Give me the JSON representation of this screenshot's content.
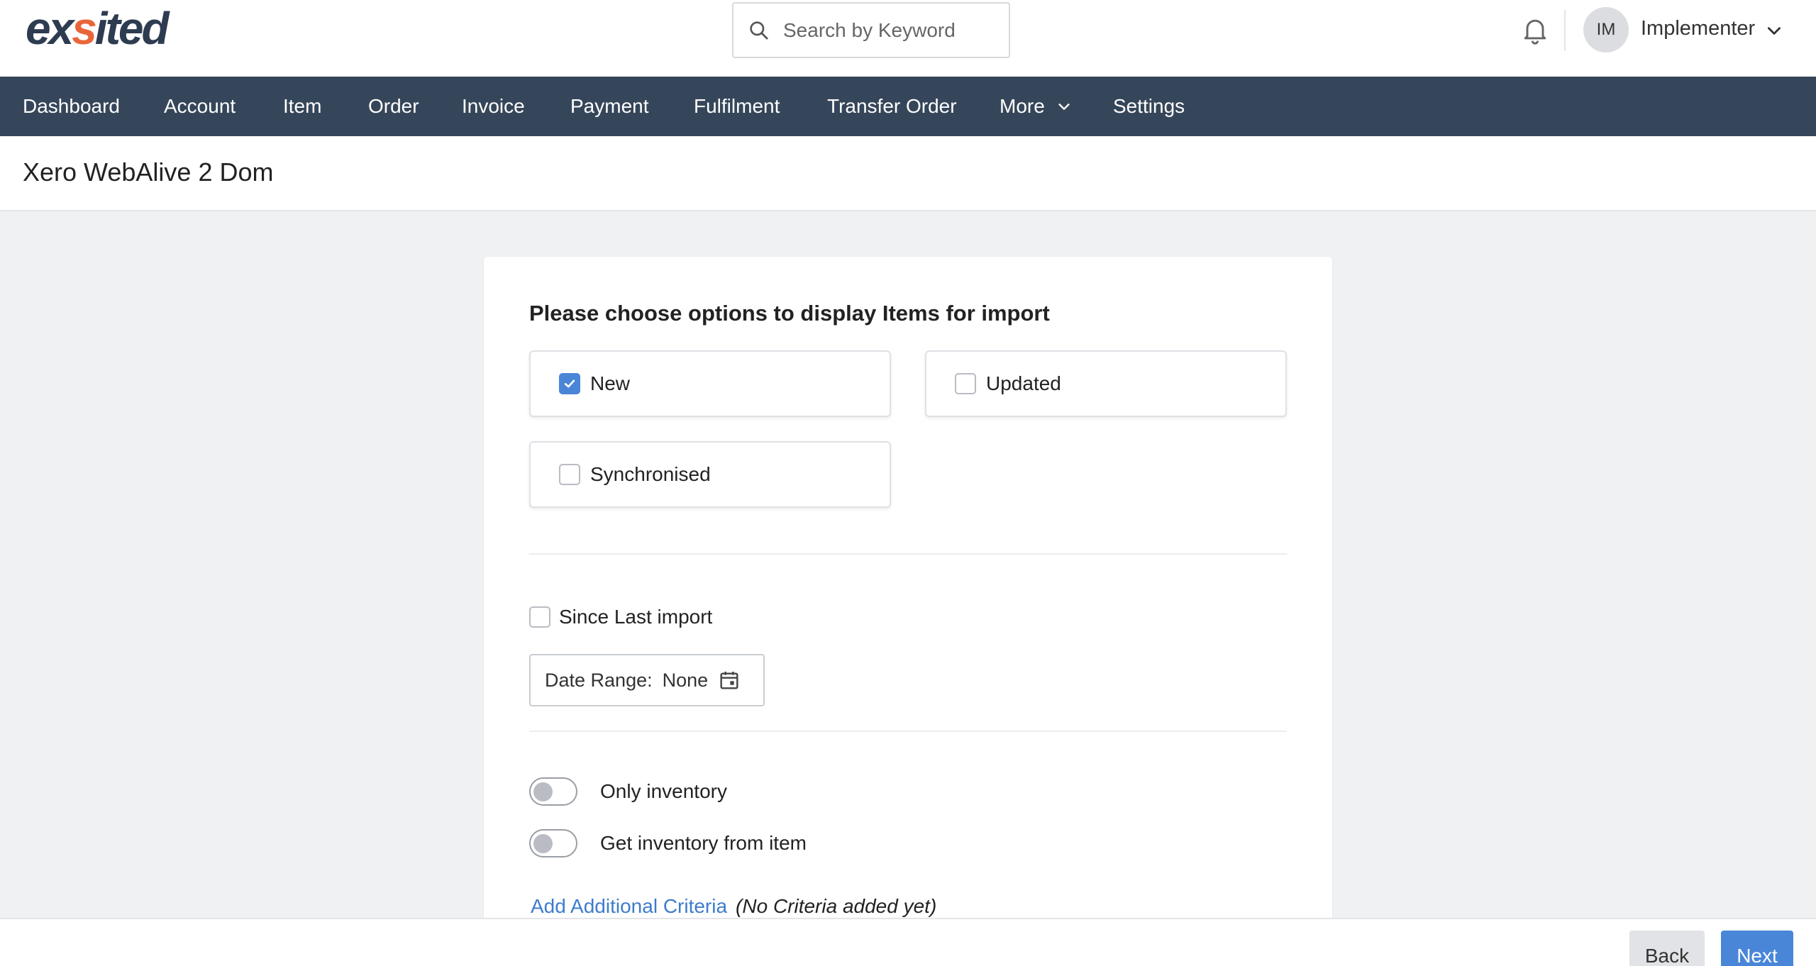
{
  "header": {
    "logo_text_left": "ex",
    "logo_text_accent": "s",
    "logo_text_right": "ited",
    "search_placeholder": "Search by Keyword",
    "user_initials": "IM",
    "user_name": "Implementer"
  },
  "nav": {
    "items": [
      "Dashboard",
      "Account",
      "Item",
      "Order",
      "Invoice",
      "Payment",
      "Fulfilment",
      "Transfer Order",
      "More",
      "Settings"
    ]
  },
  "page": {
    "title": "Xero WebAlive 2 Dom"
  },
  "form": {
    "heading": "Please choose options to display Items for import",
    "options": [
      {
        "label": "New",
        "checked": true
      },
      {
        "label": "Updated",
        "checked": false
      },
      {
        "label": "Synchronised",
        "checked": false
      }
    ],
    "since_last_import": {
      "label": "Since Last import",
      "checked": false
    },
    "date_range": {
      "label": "Date Range:",
      "value": "None"
    },
    "toggles": [
      {
        "label": "Only inventory",
        "on": false
      },
      {
        "label": "Get inventory from item",
        "on": false
      }
    ],
    "criteria_link": "Add Additional Criteria",
    "criteria_note": "(No Criteria added yet)"
  },
  "footer": {
    "back_label": "Back",
    "next_label": "Next"
  },
  "colors": {
    "nav_bg": "#36465a",
    "accent_blue": "#4a86d8",
    "logo_dark": "#2e3c51",
    "logo_accent": "#e9663a"
  }
}
